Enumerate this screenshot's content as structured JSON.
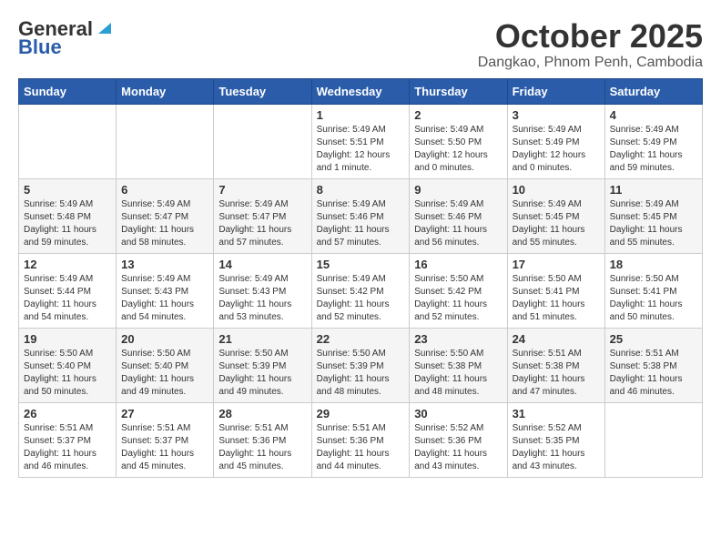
{
  "header": {
    "logo_general": "General",
    "logo_blue": "Blue",
    "month_title": "October 2025",
    "subtitle": "Dangkao, Phnom Penh, Cambodia"
  },
  "weekdays": [
    "Sunday",
    "Monday",
    "Tuesday",
    "Wednesday",
    "Thursday",
    "Friday",
    "Saturday"
  ],
  "weeks": [
    [
      {
        "day": "",
        "info": ""
      },
      {
        "day": "",
        "info": ""
      },
      {
        "day": "",
        "info": ""
      },
      {
        "day": "1",
        "info": "Sunrise: 5:49 AM\nSunset: 5:51 PM\nDaylight: 12 hours\nand 1 minute."
      },
      {
        "day": "2",
        "info": "Sunrise: 5:49 AM\nSunset: 5:50 PM\nDaylight: 12 hours\nand 0 minutes."
      },
      {
        "day": "3",
        "info": "Sunrise: 5:49 AM\nSunset: 5:49 PM\nDaylight: 12 hours\nand 0 minutes."
      },
      {
        "day": "4",
        "info": "Sunrise: 5:49 AM\nSunset: 5:49 PM\nDaylight: 11 hours\nand 59 minutes."
      }
    ],
    [
      {
        "day": "5",
        "info": "Sunrise: 5:49 AM\nSunset: 5:48 PM\nDaylight: 11 hours\nand 59 minutes."
      },
      {
        "day": "6",
        "info": "Sunrise: 5:49 AM\nSunset: 5:47 PM\nDaylight: 11 hours\nand 58 minutes."
      },
      {
        "day": "7",
        "info": "Sunrise: 5:49 AM\nSunset: 5:47 PM\nDaylight: 11 hours\nand 57 minutes."
      },
      {
        "day": "8",
        "info": "Sunrise: 5:49 AM\nSunset: 5:46 PM\nDaylight: 11 hours\nand 57 minutes."
      },
      {
        "day": "9",
        "info": "Sunrise: 5:49 AM\nSunset: 5:46 PM\nDaylight: 11 hours\nand 56 minutes."
      },
      {
        "day": "10",
        "info": "Sunrise: 5:49 AM\nSunset: 5:45 PM\nDaylight: 11 hours\nand 55 minutes."
      },
      {
        "day": "11",
        "info": "Sunrise: 5:49 AM\nSunset: 5:45 PM\nDaylight: 11 hours\nand 55 minutes."
      }
    ],
    [
      {
        "day": "12",
        "info": "Sunrise: 5:49 AM\nSunset: 5:44 PM\nDaylight: 11 hours\nand 54 minutes."
      },
      {
        "day": "13",
        "info": "Sunrise: 5:49 AM\nSunset: 5:43 PM\nDaylight: 11 hours\nand 54 minutes."
      },
      {
        "day": "14",
        "info": "Sunrise: 5:49 AM\nSunset: 5:43 PM\nDaylight: 11 hours\nand 53 minutes."
      },
      {
        "day": "15",
        "info": "Sunrise: 5:49 AM\nSunset: 5:42 PM\nDaylight: 11 hours\nand 52 minutes."
      },
      {
        "day": "16",
        "info": "Sunrise: 5:50 AM\nSunset: 5:42 PM\nDaylight: 11 hours\nand 52 minutes."
      },
      {
        "day": "17",
        "info": "Sunrise: 5:50 AM\nSunset: 5:41 PM\nDaylight: 11 hours\nand 51 minutes."
      },
      {
        "day": "18",
        "info": "Sunrise: 5:50 AM\nSunset: 5:41 PM\nDaylight: 11 hours\nand 50 minutes."
      }
    ],
    [
      {
        "day": "19",
        "info": "Sunrise: 5:50 AM\nSunset: 5:40 PM\nDaylight: 11 hours\nand 50 minutes."
      },
      {
        "day": "20",
        "info": "Sunrise: 5:50 AM\nSunset: 5:40 PM\nDaylight: 11 hours\nand 49 minutes."
      },
      {
        "day": "21",
        "info": "Sunrise: 5:50 AM\nSunset: 5:39 PM\nDaylight: 11 hours\nand 49 minutes."
      },
      {
        "day": "22",
        "info": "Sunrise: 5:50 AM\nSunset: 5:39 PM\nDaylight: 11 hours\nand 48 minutes."
      },
      {
        "day": "23",
        "info": "Sunrise: 5:50 AM\nSunset: 5:38 PM\nDaylight: 11 hours\nand 48 minutes."
      },
      {
        "day": "24",
        "info": "Sunrise: 5:51 AM\nSunset: 5:38 PM\nDaylight: 11 hours\nand 47 minutes."
      },
      {
        "day": "25",
        "info": "Sunrise: 5:51 AM\nSunset: 5:38 PM\nDaylight: 11 hours\nand 46 minutes."
      }
    ],
    [
      {
        "day": "26",
        "info": "Sunrise: 5:51 AM\nSunset: 5:37 PM\nDaylight: 11 hours\nand 46 minutes."
      },
      {
        "day": "27",
        "info": "Sunrise: 5:51 AM\nSunset: 5:37 PM\nDaylight: 11 hours\nand 45 minutes."
      },
      {
        "day": "28",
        "info": "Sunrise: 5:51 AM\nSunset: 5:36 PM\nDaylight: 11 hours\nand 45 minutes."
      },
      {
        "day": "29",
        "info": "Sunrise: 5:51 AM\nSunset: 5:36 PM\nDaylight: 11 hours\nand 44 minutes."
      },
      {
        "day": "30",
        "info": "Sunrise: 5:52 AM\nSunset: 5:36 PM\nDaylight: 11 hours\nand 43 minutes."
      },
      {
        "day": "31",
        "info": "Sunrise: 5:52 AM\nSunset: 5:35 PM\nDaylight: 11 hours\nand 43 minutes."
      },
      {
        "day": "",
        "info": ""
      }
    ]
  ]
}
